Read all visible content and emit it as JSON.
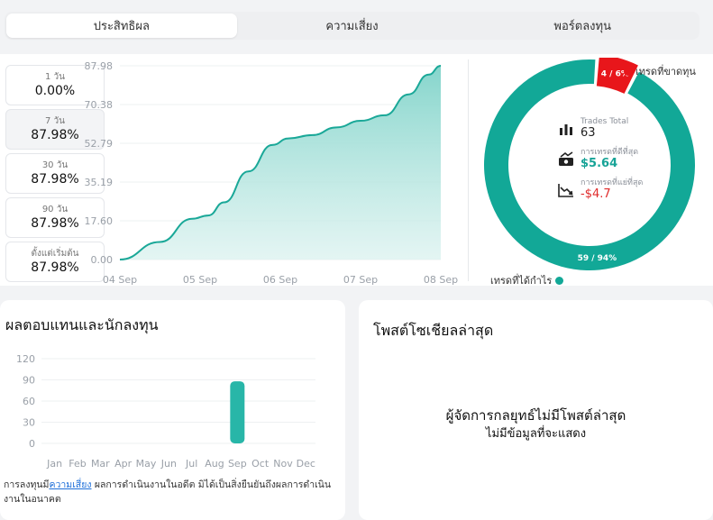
{
  "tabs": [
    {
      "label": "ประสิทธิผล",
      "active": true
    },
    {
      "label": "ความเสี่ยง",
      "active": false
    },
    {
      "label": "พอร์ตลงทุน",
      "active": false
    }
  ],
  "periods": [
    {
      "label": "1 วัน",
      "value": "0.00%"
    },
    {
      "label": "7 วัน",
      "value": "87.98%"
    },
    {
      "label": "30 วัน",
      "value": "87.98%"
    },
    {
      "label": "90 วัน",
      "value": "87.98%"
    },
    {
      "label": "ตั้งแต่เริ่มต้น",
      "value": "87.98%"
    }
  ],
  "trades": {
    "total_label": "Trades Total",
    "total_value": "63",
    "best_label": "การเทรดที่ดีที่สุด",
    "best_value": "$5.64",
    "worst_label": "การเทรดที่แย่ที่สุด",
    "worst_value": "-$4.7",
    "loss_legend": "เทรดที่ขาดทุน",
    "win_legend": "เทรดที่ได้กำไร",
    "loss_badge": "4 / 6%",
    "win_badge": "59 / 94%",
    "loss_color": "#e8161b",
    "win_color": "#12a897"
  },
  "returns_section": {
    "title": "ผลตอบแทนและนักลงทุน",
    "disclaimer_prefix": "การลงทุนมี",
    "disclaimer_link": "ความเสี่ยง",
    "disclaimer_suffix": " ผลการดำเนินงานในอดีต มิได้เป็นสิ่งยืนยันถึงผลการดำเนินงานในอนาคต"
  },
  "social_section": {
    "title": "โพสต์โซเชียลล่าสุด",
    "empty_title": "ผู้จัดการกลยุทธ์ไม่มีโพสต์ล่าสุด",
    "empty_subtitle": "ไม่มีข้อมูลที่จะแสดง"
  },
  "chart_data": [
    {
      "type": "area",
      "x": [
        "04 Sep",
        "05 Sep",
        "06 Sep",
        "07 Sep",
        "08 Sep"
      ],
      "points": [
        [
          0.0,
          0.0
        ],
        [
          0.5,
          8.0
        ],
        [
          0.9,
          18.5
        ],
        [
          1.1,
          20.0
        ],
        [
          1.3,
          26.0
        ],
        [
          1.6,
          40.0
        ],
        [
          1.9,
          52.0
        ],
        [
          2.1,
          55.0
        ],
        [
          2.4,
          56.5
        ],
        [
          2.7,
          60.0
        ],
        [
          3.0,
          63.0
        ],
        [
          3.3,
          65.5
        ],
        [
          3.6,
          75.0
        ],
        [
          3.85,
          84.0
        ],
        [
          4.0,
          87.98
        ]
      ],
      "yticks": [
        0.0,
        17.6,
        35.19,
        52.79,
        70.38,
        87.98
      ],
      "ylim": [
        0,
        87.98
      ],
      "color": "#1aa898"
    },
    {
      "type": "pie",
      "labels": [
        "เทรดที่ได้กำไร",
        "เทรดที่ขาดทุน"
      ],
      "values": [
        59,
        4
      ],
      "percents": [
        94,
        6
      ],
      "colors": [
        "#12a897",
        "#e8161b"
      ]
    },
    {
      "type": "bar",
      "categories": [
        "Jan",
        "Feb",
        "Mar",
        "Apr",
        "May",
        "Jun",
        "Jul",
        "Aug",
        "Sep",
        "Oct",
        "Nov",
        "Dec"
      ],
      "values": [
        0,
        0,
        0,
        0,
        0,
        0,
        0,
        0,
        87.98,
        0,
        0,
        0
      ],
      "yticks": [
        0,
        30,
        60,
        90,
        120
      ],
      "ylim": [
        0,
        120
      ],
      "color": "#28b6a8"
    }
  ]
}
